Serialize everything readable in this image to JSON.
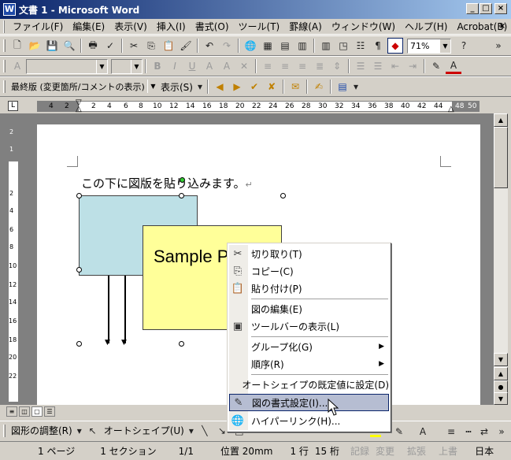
{
  "title_bar": {
    "icon_text": "W",
    "title": "文書 1 - Microsoft Word"
  },
  "menu": {
    "items": [
      "ファイル(F)",
      "編集(E)",
      "表示(V)",
      "挿入(I)",
      "書式(O)",
      "ツール(T)",
      "罫線(A)",
      "ウィンドウ(W)",
      "ヘルプ(H)",
      "Acrobat(B)"
    ]
  },
  "standard_toolbar": {
    "zoom": "71%"
  },
  "formatting_toolbar": {
    "style": "",
    "font_size": ""
  },
  "reviewing_toolbar": {
    "display_mode": "最終版 (変更箇所/コメントの表示)",
    "show_button": "表示(S)"
  },
  "ruler": {
    "labels": [
      "4",
      "2",
      "2",
      "4",
      "6",
      "8",
      "10",
      "12",
      "14",
      "16",
      "18",
      "20",
      "22",
      "24",
      "26",
      "28",
      "30",
      "32",
      "34",
      "36",
      "38",
      "40",
      "42",
      "44",
      "48",
      "50"
    ]
  },
  "vertical_ruler": {
    "labels": [
      "2",
      "1",
      "2",
      "4",
      "6",
      "8",
      "10",
      "12",
      "14",
      "16",
      "18",
      "20",
      "22"
    ]
  },
  "document": {
    "text": "この下に図版を貼り込みます。",
    "paragraph_mark": "↵",
    "sample_text": "Sample P"
  },
  "context_menu": {
    "items": [
      {
        "label": "切り取り(T)",
        "icon": "scissors-icon",
        "glyph": "✂"
      },
      {
        "label": "コピー(C)",
        "icon": "copy-icon",
        "glyph": "⎘"
      },
      {
        "label": "貼り付け(P)",
        "icon": "paste-icon",
        "glyph": "📋"
      },
      {
        "label": "図の編集(E)",
        "icon": "",
        "glyph": ""
      },
      {
        "label": "ツールバーの表示(L)",
        "icon": "toolbar-icon",
        "glyph": "▣"
      },
      {
        "label": "グループ化(G)",
        "icon": "",
        "glyph": "",
        "submenu": true
      },
      {
        "label": "順序(R)",
        "icon": "",
        "glyph": "",
        "submenu": true
      },
      {
        "label": "オートシェイプの既定値に設定(D)",
        "icon": "",
        "glyph": ""
      },
      {
        "label": "図の書式設定(I)...",
        "icon": "format-picture-icon",
        "glyph": "✎",
        "highlighted": true
      },
      {
        "label": "ハイパーリンク(H)...",
        "icon": "hyperlink-icon",
        "glyph": "🌐"
      }
    ]
  },
  "drawing_toolbar": {
    "draw": "図形の調整(R)",
    "autoshapes": "オートシェイプ(U)"
  },
  "status_bar": {
    "page": "1 ページ",
    "section": "1 セクション",
    "page_count": "1/1",
    "position": "位置 20mm",
    "line": "1 行",
    "column": "15 桁",
    "rec": "記録",
    "trk": "変更",
    "ext": "拡張",
    "ovr": "上書",
    "language": "日本"
  },
  "colors": {
    "titlebar": "#0a246a",
    "shape_blue": "#bde0e6",
    "shape_yellow": "#ffff99",
    "menu_highlight": "#b6bdd2"
  }
}
